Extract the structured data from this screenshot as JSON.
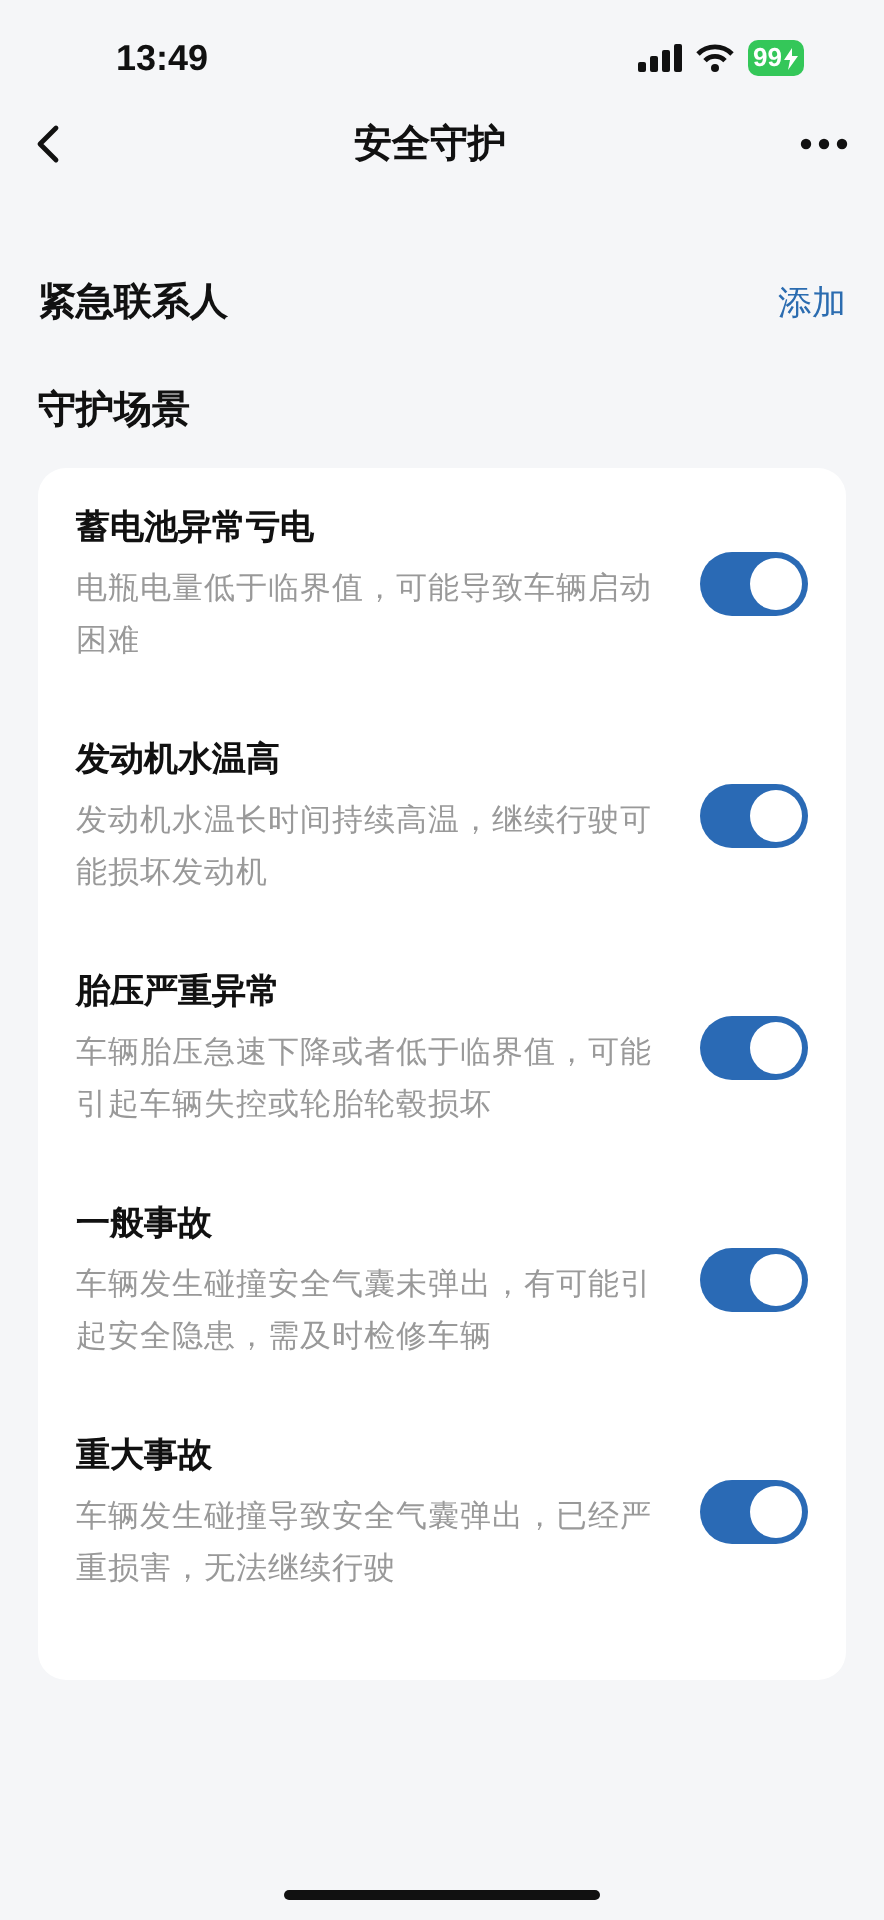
{
  "status_bar": {
    "time": "13:49",
    "battery": "99"
  },
  "nav": {
    "title": "安全守护"
  },
  "contacts": {
    "title": "紧急联系人",
    "action": "添加"
  },
  "scenes": {
    "title": "守护场景",
    "items": [
      {
        "title": "蓄电池异常亏电",
        "description": "电瓶电量低于临界值，可能导致车辆启动困难",
        "on": true
      },
      {
        "title": "发动机水温高",
        "description": "发动机水温长时间持续高温，继续行驶可能损坏发动机",
        "on": true
      },
      {
        "title": "胎压严重异常",
        "description": "车辆胎压急速下降或者低于临界值，可能引起车辆失控或轮胎轮毂损坏",
        "on": true
      },
      {
        "title": "一般事故",
        "description": "车辆发生碰撞安全气囊未弹出，有可能引起安全隐患，需及时检修车辆",
        "on": true
      },
      {
        "title": "重大事故",
        "description": "车辆发生碰撞导致安全气囊弹出，已经严重损害，无法继续行驶",
        "on": true
      }
    ]
  }
}
